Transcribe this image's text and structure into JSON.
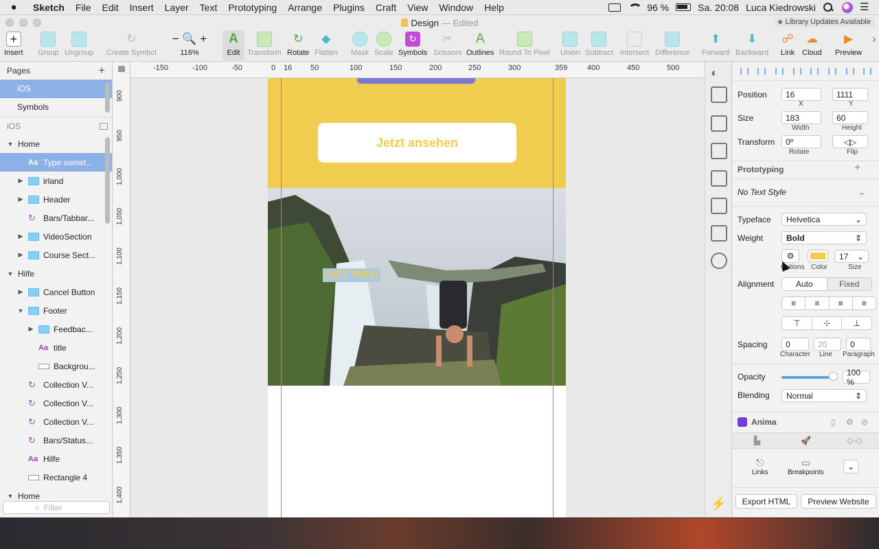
{
  "menubar": {
    "app": "Sketch",
    "items": [
      "File",
      "Edit",
      "Insert",
      "Layer",
      "Text",
      "Prototyping",
      "Arrange",
      "Plugins",
      "Craft",
      "View",
      "Window",
      "Help"
    ],
    "battery": "96 %",
    "datetime": "Sa. 20:08",
    "user": "Luca Kiedrowski"
  },
  "window": {
    "doc_title": "Design",
    "doc_state": "— Edited",
    "library_notice": "Library Updates Available"
  },
  "toolbar": {
    "insert": "Insert",
    "group": "Group",
    "ungroup": "Ungroup",
    "create_symbol": "Create Symbol",
    "zoom": "116%",
    "edit": "Edit",
    "transform": "Transform",
    "rotate": "Rotate",
    "flatten": "Flatten",
    "mask": "Mask",
    "scale": "Scale",
    "symbols": "Symbols",
    "scissors": "Scissors",
    "outlines": "Outlines",
    "round_to_pixel": "Round To Pixel",
    "union": "Union",
    "subtract": "Subtract",
    "intersect": "Intersect",
    "difference": "Difference",
    "forward": "Forward",
    "backward": "Backward",
    "link": "Link",
    "cloud": "Cloud",
    "preview": "Preview"
  },
  "sidebar": {
    "pages_title": "Pages",
    "pages": [
      "iOS",
      "Symbols"
    ],
    "current_page": "iOS",
    "layers": [
      {
        "label": "Home",
        "level": 0,
        "tri": "▼",
        "icon": "none"
      },
      {
        "label": "Type somet...",
        "level": 1,
        "tri": "",
        "icon": "text",
        "selected": true
      },
      {
        "label": "irland",
        "level": 1,
        "tri": "▶",
        "icon": "folder"
      },
      {
        "label": "Header",
        "level": 1,
        "tri": "▶",
        "icon": "folder"
      },
      {
        "label": "Bars/Tabbar...",
        "level": 1,
        "tri": "",
        "icon": "symbol"
      },
      {
        "label": "VideoSection",
        "level": 1,
        "tri": "▶",
        "icon": "folder"
      },
      {
        "label": "Course Sect...",
        "level": 1,
        "tri": "▶",
        "icon": "folder"
      },
      {
        "label": "Hilfe",
        "level": 0,
        "tri": "▼",
        "icon": "none"
      },
      {
        "label": "Cancel Button",
        "level": 1,
        "tri": "▶",
        "icon": "folder"
      },
      {
        "label": "Footer",
        "level": 1,
        "tri": "▼",
        "icon": "folder"
      },
      {
        "label": "Feedbac...",
        "level": 2,
        "tri": "▶",
        "icon": "folder"
      },
      {
        "label": "title",
        "level": 2,
        "tri": "",
        "icon": "text"
      },
      {
        "label": "Backgrou...",
        "level": 2,
        "tri": "",
        "icon": "rect"
      },
      {
        "label": "Collection V...",
        "level": 1,
        "tri": "",
        "icon": "symbol"
      },
      {
        "label": "Collection V...",
        "level": 1,
        "tri": "",
        "icon": "symbol"
      },
      {
        "label": "Collection V...",
        "level": 1,
        "tri": "",
        "icon": "symbol"
      },
      {
        "label": "Bars/Status...",
        "level": 1,
        "tri": "",
        "icon": "symbol"
      },
      {
        "label": "Hilfe",
        "level": 1,
        "tri": "",
        "icon": "text"
      },
      {
        "label": "Rectangle 4",
        "level": 1,
        "tri": "",
        "icon": "rect"
      },
      {
        "label": "Home",
        "level": 0,
        "tri": "▼",
        "icon": "none"
      }
    ],
    "filter_placeholder": "Filter"
  },
  "canvas": {
    "ruler_top": [
      "-150",
      "-100",
      "-50",
      "0",
      "16",
      "50",
      "100",
      "150",
      "200",
      "250",
      "300",
      "359",
      "400",
      "450",
      "500"
    ],
    "ruler_left": [
      "900",
      "950",
      "1,000",
      "1,050",
      "1,100",
      "1,150",
      "1,200",
      "1,250",
      "1,300",
      "1,350",
      "1,400"
    ],
    "cta_label": "Jetzt ansehen",
    "selected_text": "GET PRO",
    "yellow": "#f0cc4f"
  },
  "inspector": {
    "position_label": "Position",
    "x": "16",
    "y": "1111",
    "x_label": "X",
    "y_label": "Y",
    "size_label": "Size",
    "width": "183",
    "height": "60",
    "width_label": "Width",
    "height_label": "Height",
    "transform_label": "Transform",
    "rotate": "0º",
    "rotate_label": "Rotate",
    "flip_label": "Flip",
    "prototyping": "Prototyping",
    "text_style": "No Text Style",
    "typeface_label": "Typeface",
    "typeface": "Helvetica",
    "weight_label": "Weight",
    "weight": "Bold",
    "options_label": "Options",
    "color_label": "Color",
    "size_value": "17",
    "size_caption": "Size",
    "alignment_label": "Alignment",
    "align_auto": "Auto",
    "align_fixed": "Fixed",
    "spacing_label": "Spacing",
    "char_spacing": "0",
    "line_spacing": "20",
    "para_spacing": "0",
    "character_label": "Character",
    "line_label": "Line",
    "paragraph_label": "Paragraph",
    "opacity_label": "Opacity",
    "opacity": "100 %",
    "blending_label": "Blending",
    "blending": "Normal",
    "anima": "Anima",
    "links": "Links",
    "breakpoints": "Breakpoints",
    "export_html": "Export HTML",
    "preview_website": "Preview Website"
  }
}
